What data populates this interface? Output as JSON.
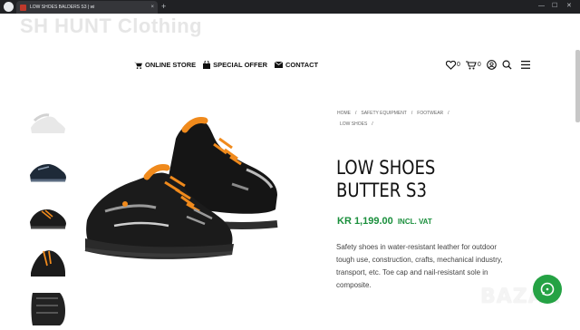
{
  "browser": {
    "tab_title": "LOW SHOES BALDERS S3 | wi",
    "tab_close": "×",
    "new_tab": "+",
    "win_min": "—",
    "win_max": "☐",
    "win_close": "✕"
  },
  "brand": {
    "name": "SH HUNT Clothing"
  },
  "nav": {
    "items": [
      {
        "label": "ONLINE STORE",
        "icon": "cart-icon"
      },
      {
        "label": "SPECIAL OFFER",
        "icon": "bag-icon"
      },
      {
        "label": "CONTACT",
        "icon": "envelope-icon"
      }
    ]
  },
  "header_icons": {
    "wishlist_count": "0",
    "cart_count": "0"
  },
  "breadcrumb": {
    "items": [
      "HOME",
      "SAFETY EQUIPMENT",
      "FOOTWEAR",
      "LOW SHOES"
    ],
    "separator": "/"
  },
  "product": {
    "title_line1": "LOW SHOES",
    "title_line2": "BUTTER S3",
    "price": "KR 1,199.00",
    "price_suffix": "INCL. VAT",
    "description": "Safety shoes in water-resistant leather for outdoor tough use, construction, crafts, mechanical industry, transport, etc. Toe cap and nail-resistant sole in composite."
  },
  "watermark": {
    "text": "BAZAR"
  },
  "colors": {
    "price_green": "#1a8f3c",
    "shoe_orange": "#f08a1c",
    "chat_green": "#25a244"
  }
}
